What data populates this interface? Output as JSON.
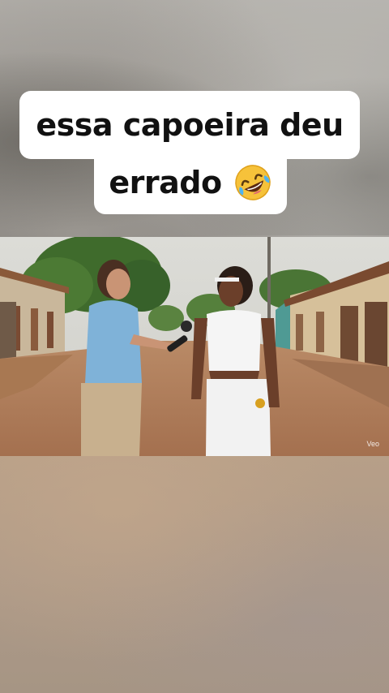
{
  "caption": {
    "line1": "essa capoeira deu",
    "line2": "errado"
  },
  "video": {
    "watermark": "Veo"
  },
  "icons": {
    "caption_emoji": "rolling-on-floor-laughing-icon"
  },
  "colors": {
    "caption_bg": "#ffffff",
    "caption_text": "#111111"
  }
}
